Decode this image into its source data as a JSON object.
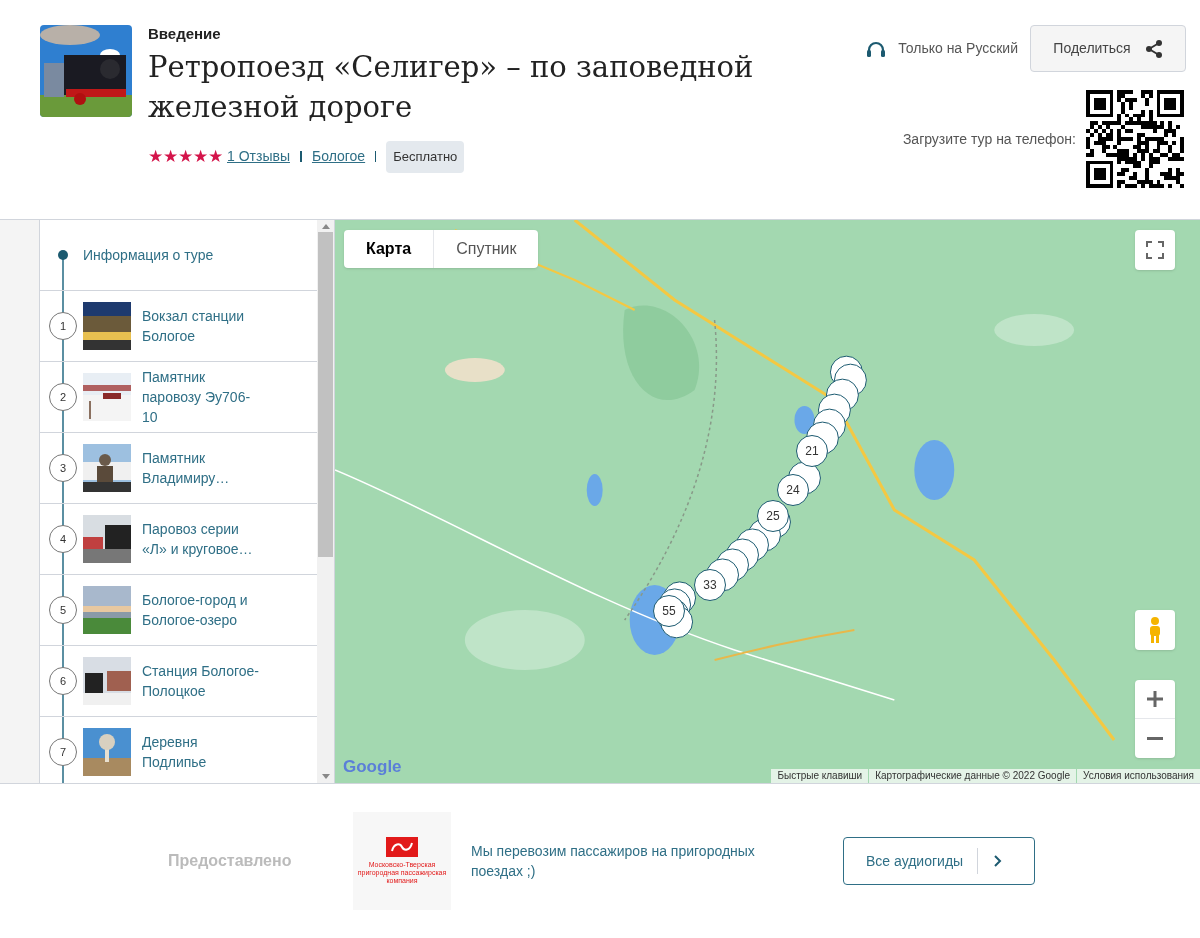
{
  "header": {
    "section": "Введение",
    "title": "Ретропоезд «Селигер» – по заповедной железной дороге",
    "stars": 5,
    "reviews": "1 Отзывы",
    "city": "Бологое",
    "price": "Бесплатно",
    "language": "Только на Русский",
    "share_button": "Поделиться",
    "download_label": "Загрузите тур на телефон:"
  },
  "sidebar": {
    "intro": "Информация о туре",
    "stops": [
      {
        "number": "1",
        "label": "Вокзал станции Бологое"
      },
      {
        "number": "2",
        "label": "Памятник паровозу Эу706-10"
      },
      {
        "number": "3",
        "label": "Памятник Владимиру…"
      },
      {
        "number": "4",
        "label": "Паровоз серии «Л» и круговое…"
      },
      {
        "number": "5",
        "label": "Бологое-город и Бологое-озеро"
      },
      {
        "number": "6",
        "label": "Станция Бологое-Полоцкое"
      },
      {
        "number": "7",
        "label": "Деревня Подлипье"
      }
    ]
  },
  "map": {
    "tabs": [
      {
        "label": "Карта",
        "selected": true
      },
      {
        "label": "Спутник",
        "selected": false
      }
    ],
    "markers": [
      "21",
      "24",
      "25",
      "33",
      "55"
    ],
    "logo": "Google",
    "attribution": [
      "Быстрые клавиши",
      "Картографические данные © 2022 Google",
      "Условия использования"
    ]
  },
  "footer": {
    "provided_label": "Предоставлено",
    "partner_logo_text": "Московско-Тверская пригородная пассажирская компания",
    "description": "Мы перевозим пассажиров на пригородных поездах ;)",
    "all_guides_button": "Все аудиогиды"
  }
}
